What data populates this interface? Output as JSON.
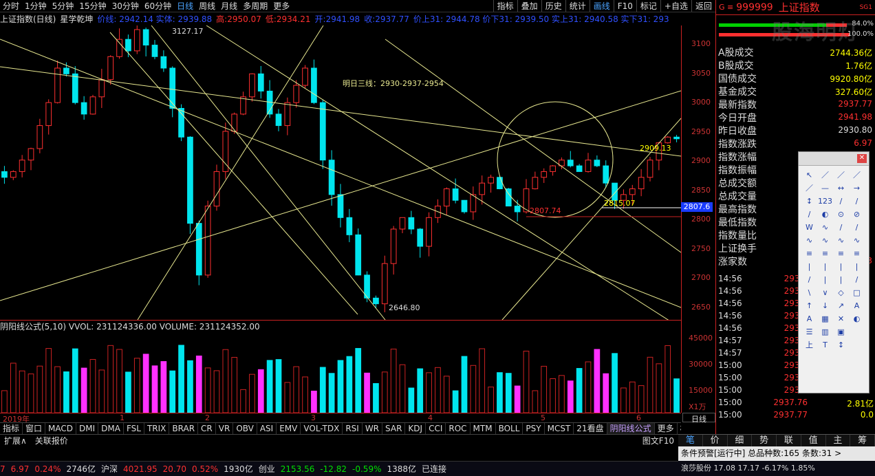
{
  "topbar": {
    "tabs": [
      "分时",
      "1分钟",
      "5分钟",
      "15分钟",
      "30分钟",
      "60分钟",
      "日线",
      "周线",
      "月线",
      "多周期",
      "更多"
    ],
    "active": "日线",
    "right": [
      "指标",
      "叠加",
      "历史",
      "统计",
      "画线",
      "F10",
      "标记",
      "+自选",
      "返回"
    ],
    "right_active": "画线"
  },
  "info": {
    "title": "上证指数(日线)",
    "study": "星学乾坤",
    "open_lbl": "开:",
    "open": "2941.98",
    "close_lbl": "收:",
    "close": "2937.77",
    "high_lbl": "高:",
    "high": "2950.07",
    "low_lbl": "低:",
    "low": "2934.21",
    "note1": "价线: 2942.14 实体: 2939.88",
    "note2": "价上31: 2944.78 价下31: 2939.50 实上31: 2940.58 实下31: 293"
  },
  "chart": {
    "annot": "明日三线：2930-2937-2954",
    "hi_label": "3127.17",
    "lo_label": "2646.80",
    "l1": "2815.07",
    "l2": "2807.74",
    "l3": "2909.13",
    "price_tag": "2807.6",
    "yticks": [
      "3100",
      "3050",
      "3000",
      "2950",
      "2900",
      "2850",
      "2800",
      "2750",
      "2700",
      "2650"
    ]
  },
  "vol": {
    "header": "阴阳线公式(5,10) VVOL: 231124336.00  VOLUME: 231124352.00",
    "yticks": [
      "45000",
      "30000",
      "15000"
    ],
    "unit": "X1万"
  },
  "timeaxis": {
    "labels": [
      "2019年",
      "1",
      "2",
      "3",
      "4",
      "5",
      "6"
    ]
  },
  "day_button": "日线",
  "tabs": {
    "items": [
      "指标",
      "窗口",
      "MACD",
      "DMI",
      "DMA",
      "FSL",
      "TRIX",
      "BRAR",
      "CR",
      "VR",
      "OBV",
      "ASI",
      "EMV",
      "VOL-TDX",
      "RSI",
      "WR",
      "SAR",
      "KDJ",
      "CCI",
      "ROC",
      "MTM",
      "BOLL",
      "PSY",
      "MCST",
      "21看盘",
      "阴阳线公式",
      "更多",
      "模板"
    ],
    "active": "阴阳线公式"
  },
  "subtabs": {
    "items": [
      "扩展∧",
      "关联报价"
    ],
    "right": [
      "图文F10",
      "侧边栏"
    ]
  },
  "right": {
    "code": "999999",
    "name": "上证指数",
    "sg": "SG1",
    "bar1": "84.0%",
    "bar2": "100.0%",
    "stats": [
      {
        "k": "A股成交",
        "v": "2744.36亿",
        "c": "#ffff00"
      },
      {
        "k": "B股成交",
        "v": "1.76亿",
        "c": "#ffff00"
      },
      {
        "k": "国债成交",
        "v": "9920.80亿",
        "c": "#ffff00"
      },
      {
        "k": "基金成交",
        "v": "327.60亿",
        "c": "#ffff00"
      },
      {
        "k": "最新指数",
        "v": "2937.77",
        "c": "#ff3030"
      },
      {
        "k": "今日开盘",
        "v": "2941.98",
        "c": "#ff3030"
      },
      {
        "k": "昨日收盘",
        "v": "2930.80",
        "c": "#dddddd"
      },
      {
        "k": "指数涨跌",
        "v": "6.97",
        "c": "#ff3030"
      },
      {
        "k": "指数涨幅",
        "v": "",
        "c": "#ff3030"
      },
      {
        "k": "指数振幅",
        "v": "",
        "c": "#ff3030"
      },
      {
        "k": "总成交额",
        "v": "",
        "c": "#ffff00"
      },
      {
        "k": "总成交量",
        "v": "",
        "c": "#ffff00"
      },
      {
        "k": "最高指数",
        "v": "",
        "c": "#ff3030"
      },
      {
        "k": "最低指数",
        "v": "",
        "c": "#ff3030"
      },
      {
        "k": "指数量比",
        "v": "",
        "c": "#ff3030"
      },
      {
        "k": "上证换手",
        "v": "",
        "c": "#ffff00"
      },
      {
        "k": "涨家数",
        "v": "693",
        "c": "#ff3030"
      }
    ],
    "ticks": [
      {
        "t": "14:56",
        "p": "2936.",
        "n": ""
      },
      {
        "t": "14:56",
        "p": "2936.",
        "n": ""
      },
      {
        "t": "14:56",
        "p": "2936.",
        "n": ""
      },
      {
        "t": "14:56",
        "p": "2937.",
        "n": ""
      },
      {
        "t": "14:56",
        "p": "2937.",
        "n": ""
      },
      {
        "t": "14:57",
        "p": "2937.",
        "n": ""
      },
      {
        "t": "14:57",
        "p": "2937.",
        "n": ""
      },
      {
        "t": "15:00",
        "p": "2937.",
        "n": ""
      },
      {
        "t": "15:00",
        "p": "2937.",
        "n": ""
      },
      {
        "t": "15:00",
        "p": "2937.",
        "n": ""
      },
      {
        "t": "15:00",
        "p": "2937.76",
        "n": "2.81亿"
      },
      {
        "t": "15:00",
        "p": "2937.77",
        "n": "0.0"
      }
    ],
    "bottom_tabs": [
      "笔",
      "价",
      "细",
      "势",
      "联",
      "值",
      "主",
      "筹"
    ],
    "bottom_active": "笔",
    "alert": "条件预警[运行中] 总品种数:165 条数:31  >",
    "alert_row": "浪莎股份     17.08   17.17   -6.17%   1.85%"
  },
  "status": {
    "items": [
      {
        "t": "7",
        "c": "#ff3030"
      },
      {
        "t": "6.97",
        "c": "#ff3030"
      },
      {
        "t": "0.24%",
        "c": "#ff3030"
      },
      {
        "t": "2746亿",
        "c": "#ddd"
      },
      {
        "t": "沪深",
        "c": "#ddd"
      },
      {
        "t": "4021.95",
        "c": "#ff3030"
      },
      {
        "t": "20.70",
        "c": "#ff3030"
      },
      {
        "t": "0.52%",
        "c": "#ff3030"
      },
      {
        "t": "1930亿",
        "c": "#ddd"
      },
      {
        "t": "创业",
        "c": "#ddd"
      },
      {
        "t": "2153.56",
        "c": "#00e000"
      },
      {
        "t": "-12.82",
        "c": "#00e000"
      },
      {
        "t": "-0.59%",
        "c": "#00e000"
      },
      {
        "t": "1388亿",
        "c": "#ddd"
      },
      {
        "t": "已连接",
        "c": "#ddd"
      }
    ]
  },
  "toolbox": {
    "tools": [
      "↖",
      "／",
      "／",
      "／",
      "／",
      "—",
      "↔",
      "→",
      "↕",
      "123",
      "∕",
      "∕",
      "∕",
      "◐",
      "⊙",
      "⊘",
      "W",
      "∿",
      "∕",
      "∕",
      "∿",
      "∿",
      "∿",
      "∿",
      "≡",
      "≡",
      "≡",
      "≡",
      "|",
      "|",
      "|",
      "|",
      "/",
      "|",
      "|",
      "/",
      "\\",
      "∨",
      "◇",
      "□",
      "↑",
      "↓",
      "↗",
      "A",
      "A",
      "▦",
      "✕",
      "◐",
      "☰",
      "▥",
      "▣",
      "",
      "上",
      "T",
      "↕",
      ""
    ]
  },
  "watermark": "股海明灯"
}
